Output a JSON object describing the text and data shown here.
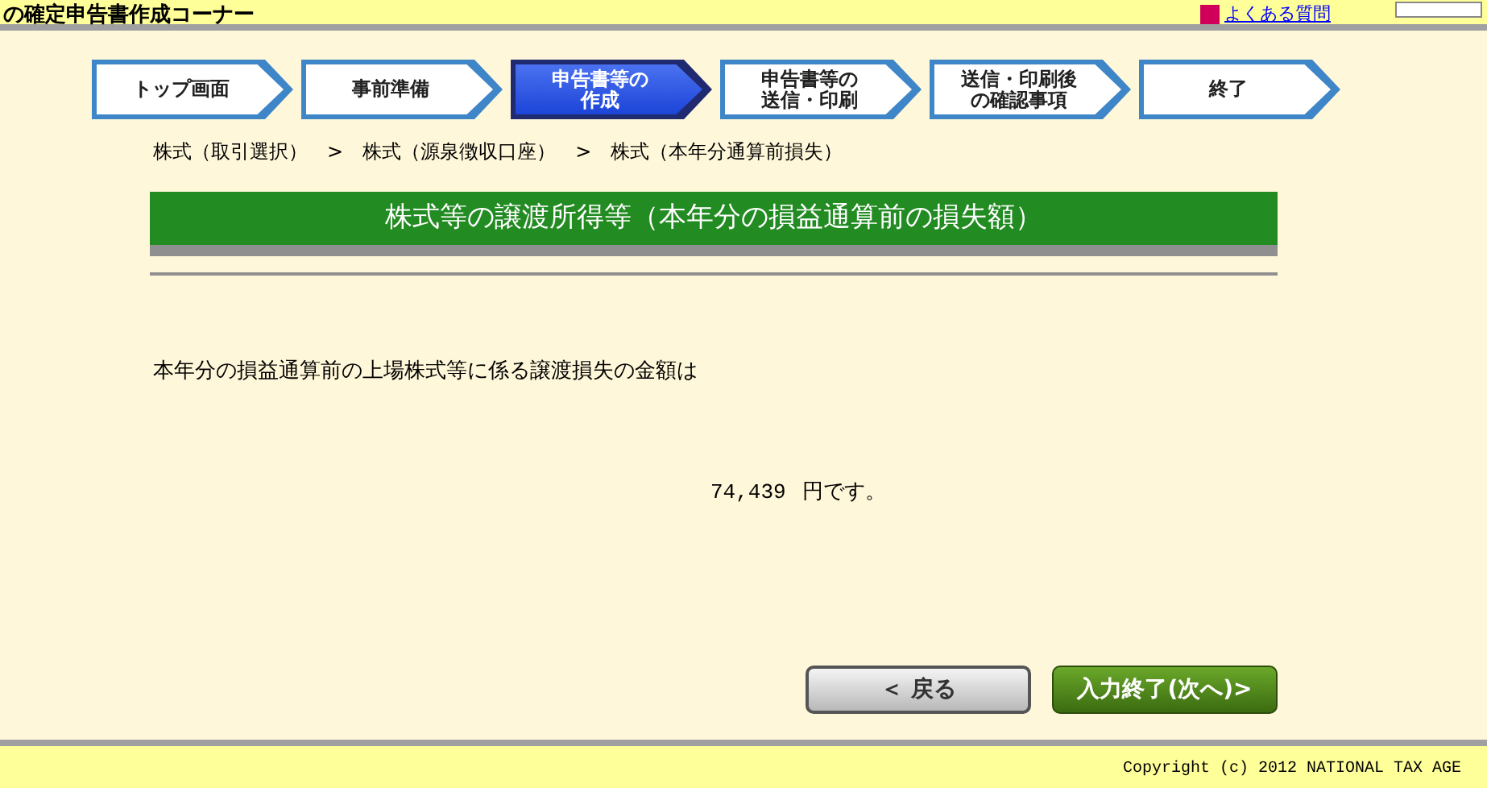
{
  "header": {
    "title": "の確定申告書作成コーナー",
    "faq_link": "よくある質問"
  },
  "steps": [
    {
      "lines": [
        "トップ画面"
      ],
      "selected": false
    },
    {
      "lines": [
        "事前準備"
      ],
      "selected": false
    },
    {
      "lines": [
        "申告書等の",
        "作成"
      ],
      "selected": true
    },
    {
      "lines": [
        "申告書等の",
        "送信・印刷"
      ],
      "selected": false
    },
    {
      "lines": [
        "送信・印刷後",
        "の確認事項"
      ],
      "selected": false
    },
    {
      "lines": [
        "終了"
      ],
      "selected": false
    }
  ],
  "breadcrumb": [
    "株式（取引選択）",
    "株式（源泉徴収口座）",
    "株式（本年分通算前損失）"
  ],
  "breadcrumb_separator": ">",
  "section_title": "株式等の譲渡所得等（本年分の損益通算前の損失額）",
  "question": "本年分の損益通算前の上場株式等に係る譲渡損失の金額は",
  "amount": "74,439",
  "amount_suffix": "円です。",
  "buttons": [
    {
      "label": "＜ 戻る",
      "kind": "back"
    },
    {
      "label": "入力終了(次へ)>",
      "kind": "next"
    }
  ],
  "footer": "Copyright (c) 2012 NATIONAL TAX AGE"
}
